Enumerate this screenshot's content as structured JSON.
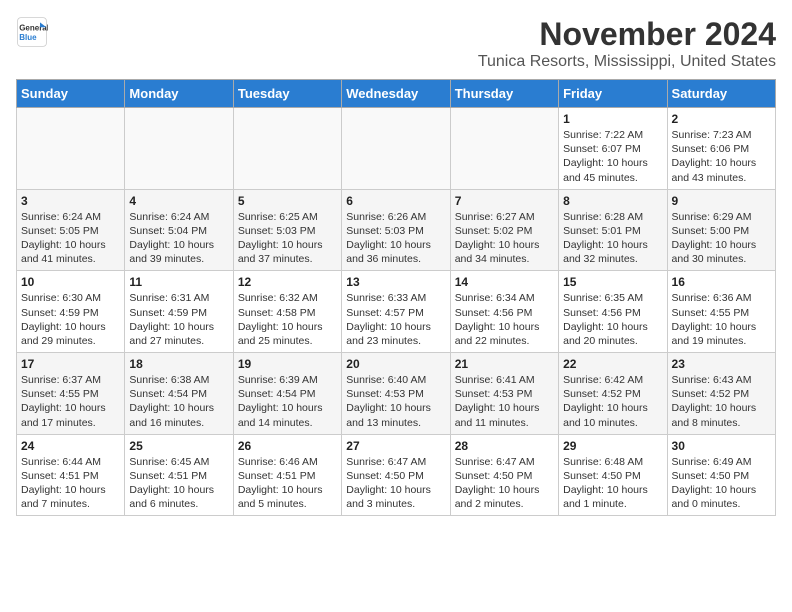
{
  "logo": {
    "line1": "General",
    "line2": "Blue"
  },
  "title": "November 2024",
  "location": "Tunica Resorts, Mississippi, United States",
  "headers": [
    "Sunday",
    "Monday",
    "Tuesday",
    "Wednesday",
    "Thursday",
    "Friday",
    "Saturday"
  ],
  "weeks": [
    [
      {
        "day": "",
        "info": ""
      },
      {
        "day": "",
        "info": ""
      },
      {
        "day": "",
        "info": ""
      },
      {
        "day": "",
        "info": ""
      },
      {
        "day": "",
        "info": ""
      },
      {
        "day": "1",
        "info": "Sunrise: 7:22 AM\nSunset: 6:07 PM\nDaylight: 10 hours and 45 minutes."
      },
      {
        "day": "2",
        "info": "Sunrise: 7:23 AM\nSunset: 6:06 PM\nDaylight: 10 hours and 43 minutes."
      }
    ],
    [
      {
        "day": "3",
        "info": "Sunrise: 6:24 AM\nSunset: 5:05 PM\nDaylight: 10 hours and 41 minutes."
      },
      {
        "day": "4",
        "info": "Sunrise: 6:24 AM\nSunset: 5:04 PM\nDaylight: 10 hours and 39 minutes."
      },
      {
        "day": "5",
        "info": "Sunrise: 6:25 AM\nSunset: 5:03 PM\nDaylight: 10 hours and 37 minutes."
      },
      {
        "day": "6",
        "info": "Sunrise: 6:26 AM\nSunset: 5:03 PM\nDaylight: 10 hours and 36 minutes."
      },
      {
        "day": "7",
        "info": "Sunrise: 6:27 AM\nSunset: 5:02 PM\nDaylight: 10 hours and 34 minutes."
      },
      {
        "day": "8",
        "info": "Sunrise: 6:28 AM\nSunset: 5:01 PM\nDaylight: 10 hours and 32 minutes."
      },
      {
        "day": "9",
        "info": "Sunrise: 6:29 AM\nSunset: 5:00 PM\nDaylight: 10 hours and 30 minutes."
      }
    ],
    [
      {
        "day": "10",
        "info": "Sunrise: 6:30 AM\nSunset: 4:59 PM\nDaylight: 10 hours and 29 minutes."
      },
      {
        "day": "11",
        "info": "Sunrise: 6:31 AM\nSunset: 4:59 PM\nDaylight: 10 hours and 27 minutes."
      },
      {
        "day": "12",
        "info": "Sunrise: 6:32 AM\nSunset: 4:58 PM\nDaylight: 10 hours and 25 minutes."
      },
      {
        "day": "13",
        "info": "Sunrise: 6:33 AM\nSunset: 4:57 PM\nDaylight: 10 hours and 23 minutes."
      },
      {
        "day": "14",
        "info": "Sunrise: 6:34 AM\nSunset: 4:56 PM\nDaylight: 10 hours and 22 minutes."
      },
      {
        "day": "15",
        "info": "Sunrise: 6:35 AM\nSunset: 4:56 PM\nDaylight: 10 hours and 20 minutes."
      },
      {
        "day": "16",
        "info": "Sunrise: 6:36 AM\nSunset: 4:55 PM\nDaylight: 10 hours and 19 minutes."
      }
    ],
    [
      {
        "day": "17",
        "info": "Sunrise: 6:37 AM\nSunset: 4:55 PM\nDaylight: 10 hours and 17 minutes."
      },
      {
        "day": "18",
        "info": "Sunrise: 6:38 AM\nSunset: 4:54 PM\nDaylight: 10 hours and 16 minutes."
      },
      {
        "day": "19",
        "info": "Sunrise: 6:39 AM\nSunset: 4:54 PM\nDaylight: 10 hours and 14 minutes."
      },
      {
        "day": "20",
        "info": "Sunrise: 6:40 AM\nSunset: 4:53 PM\nDaylight: 10 hours and 13 minutes."
      },
      {
        "day": "21",
        "info": "Sunrise: 6:41 AM\nSunset: 4:53 PM\nDaylight: 10 hours and 11 minutes."
      },
      {
        "day": "22",
        "info": "Sunrise: 6:42 AM\nSunset: 4:52 PM\nDaylight: 10 hours and 10 minutes."
      },
      {
        "day": "23",
        "info": "Sunrise: 6:43 AM\nSunset: 4:52 PM\nDaylight: 10 hours and 8 minutes."
      }
    ],
    [
      {
        "day": "24",
        "info": "Sunrise: 6:44 AM\nSunset: 4:51 PM\nDaylight: 10 hours and 7 minutes."
      },
      {
        "day": "25",
        "info": "Sunrise: 6:45 AM\nSunset: 4:51 PM\nDaylight: 10 hours and 6 minutes."
      },
      {
        "day": "26",
        "info": "Sunrise: 6:46 AM\nSunset: 4:51 PM\nDaylight: 10 hours and 5 minutes."
      },
      {
        "day": "27",
        "info": "Sunrise: 6:47 AM\nSunset: 4:50 PM\nDaylight: 10 hours and 3 minutes."
      },
      {
        "day": "28",
        "info": "Sunrise: 6:47 AM\nSunset: 4:50 PM\nDaylight: 10 hours and 2 minutes."
      },
      {
        "day": "29",
        "info": "Sunrise: 6:48 AM\nSunset: 4:50 PM\nDaylight: 10 hours and 1 minute."
      },
      {
        "day": "30",
        "info": "Sunrise: 6:49 AM\nSunset: 4:50 PM\nDaylight: 10 hours and 0 minutes."
      }
    ]
  ]
}
